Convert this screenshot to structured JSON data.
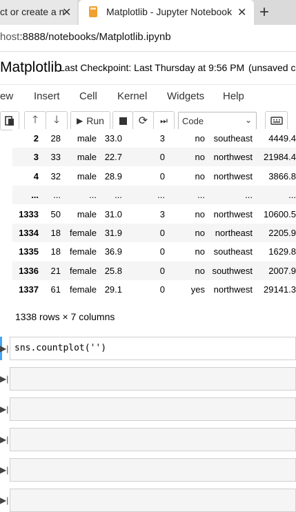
{
  "browser": {
    "tab_inactive": "ct or create a n",
    "tab_active": "Matplotlib - Jupyter Notebook",
    "url_host": "host",
    "url_rest": ":8888/notebooks/Matplotlib.ipynb"
  },
  "header": {
    "notebook_name": "Matplotlib",
    "checkpoint": "Last Checkpoint: Last Thursday at 9:56 PM",
    "unsaved": "(unsaved cl"
  },
  "menu": [
    "ew",
    "Insert",
    "Cell",
    "Kernel",
    "Widgets",
    "Help"
  ],
  "toolbar": {
    "run_label": "Run",
    "cell_type": "Code"
  },
  "table": {
    "rows": [
      [
        "2",
        "28",
        "male",
        "33.0",
        "3",
        "no",
        "southeast",
        "4449.4"
      ],
      [
        "3",
        "33",
        "male",
        "22.7",
        "0",
        "no",
        "northwest",
        "21984.4"
      ],
      [
        "4",
        "32",
        "male",
        "28.9",
        "0",
        "no",
        "northwest",
        "3866.8"
      ],
      [
        "...",
        "...",
        "...",
        "...",
        "...",
        "...",
        "...",
        "..."
      ],
      [
        "1333",
        "50",
        "male",
        "31.0",
        "3",
        "no",
        "northwest",
        "10600.5"
      ],
      [
        "1334",
        "18",
        "female",
        "31.9",
        "0",
        "no",
        "northeast",
        "2205.9"
      ],
      [
        "1335",
        "18",
        "female",
        "36.9",
        "0",
        "no",
        "southeast",
        "1629.8"
      ],
      [
        "1336",
        "21",
        "female",
        "25.8",
        "0",
        "no",
        "southwest",
        "2007.9"
      ],
      [
        "1337",
        "61",
        "female",
        "29.1",
        "0",
        "yes",
        "northwest",
        "29141.3"
      ]
    ],
    "footer": "1338 rows × 7 columns"
  },
  "cells": {
    "current_code": "sns.countplot('')"
  }
}
